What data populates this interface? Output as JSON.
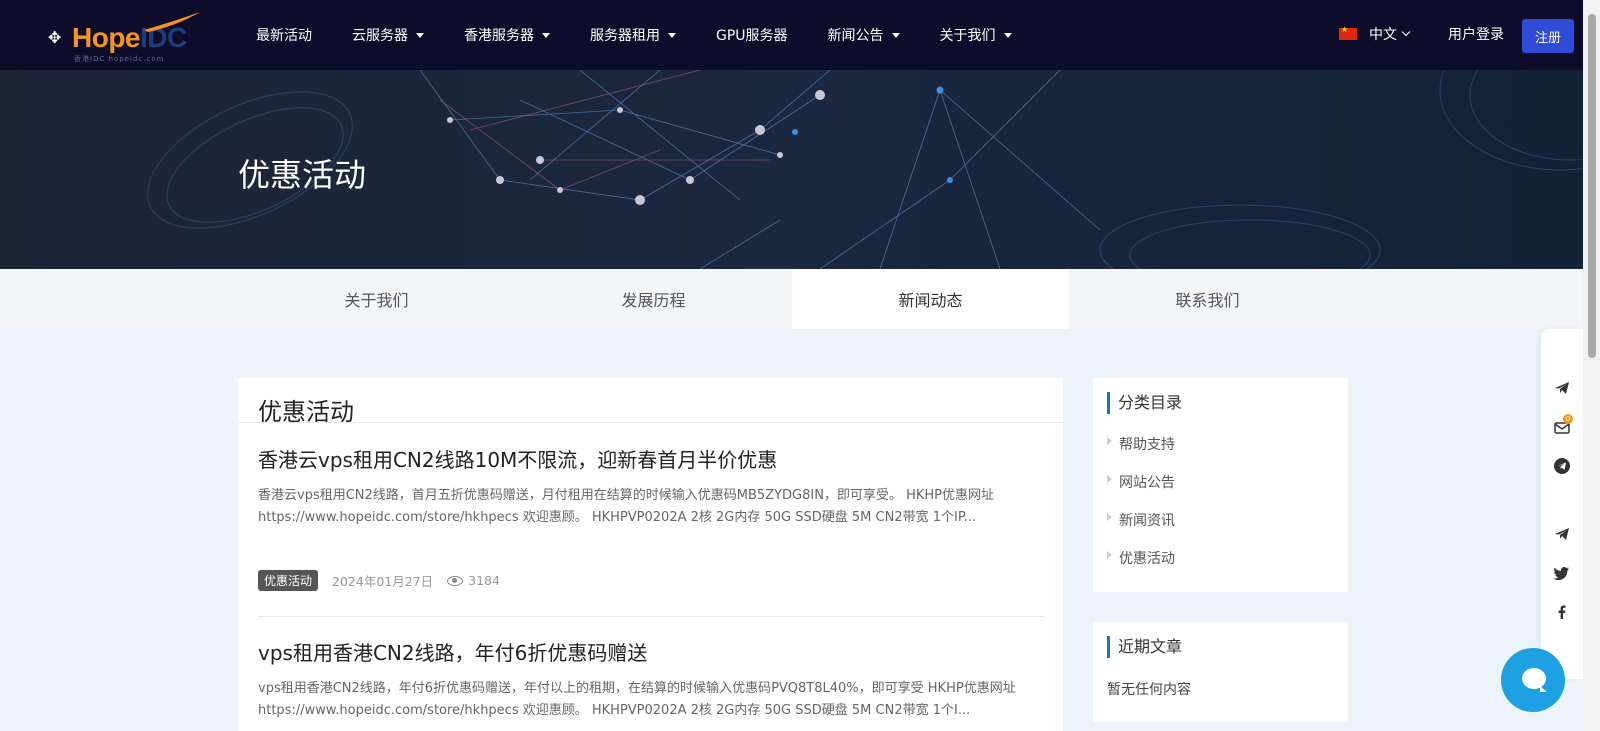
{
  "header": {
    "logo_text_a": "Hope",
    "logo_text_b": "IDC",
    "logo_tag": "香港IDC hopeidc.com",
    "nav": [
      {
        "label": "最新活动",
        "dropdown": false
      },
      {
        "label": "云服务器",
        "dropdown": true
      },
      {
        "label": "香港服务器",
        "dropdown": true
      },
      {
        "label": "服务器租用",
        "dropdown": true
      },
      {
        "label": "GPU服务器",
        "dropdown": false
      },
      {
        "label": "新闻公告",
        "dropdown": true
      },
      {
        "label": "关于我们",
        "dropdown": true
      }
    ],
    "language": "中文",
    "login_label": "用户登录",
    "register_label": "注册"
  },
  "banner": {
    "title": "优惠活动"
  },
  "tabs": [
    {
      "label": "关于我们",
      "active": false
    },
    {
      "label": "发展历程",
      "active": false
    },
    {
      "label": "新闻动态",
      "active": true
    },
    {
      "label": "联系我们",
      "active": false
    }
  ],
  "main": {
    "title": "优惠活动",
    "posts": [
      {
        "title": "香港云vps租用CN2线路10M不限流，迎新春首月半价优惠",
        "excerpt": "香港云vps租用CN2线路，首月五折优惠码赠送，月付租用在结算的时候输入优惠码MB5ZYDG8IN，即可享受。 HKHP优惠网址https://www.hopeidc.com/store/hkhpecs 欢迎惠顾。 HKHPVP0202A 2核 2G内存 50G SSD硬盘 5M CN2带宽 1个IP...",
        "category": "优惠活动",
        "date": "2024年01月27日",
        "views": "3184"
      },
      {
        "title": "vps租用香港CN2线路，年付6折优惠码赠送",
        "excerpt": "vps租用香港CN2线路，年付6折优惠码赠送，年付以上的租期，在结算的时候输入优惠码PVQ8T8L40%，即可享受 HKHP优惠网址 https://www.hopeidc.com/store/hkhpecs  欢迎惠顾。 HKHPVP0202A 2核 2G内存 50G SSD硬盘 5M CN2带宽 1个I...",
        "category": "",
        "date": "",
        "views": ""
      }
    ]
  },
  "sidebar": {
    "categories_title": "分类目录",
    "categories": [
      "帮助支持",
      "网站公告",
      "新闻资讯",
      "优惠活动"
    ],
    "recent_title": "近期文章",
    "recent_empty": "暂无任何内容"
  },
  "floatbar": {
    "icons": [
      "telegram-icon",
      "mail-icon",
      "telegram-circle-icon",
      "telegram-icon",
      "twitter-icon",
      "facebook-icon"
    ],
    "mail_badge": "0"
  },
  "colors": {
    "header_bg": "#0d0d2b",
    "accent": "#f7941d",
    "register_bg": "#2f4cd6",
    "chat_bg": "#1da1e2",
    "side_accent": "#1a73c5"
  }
}
